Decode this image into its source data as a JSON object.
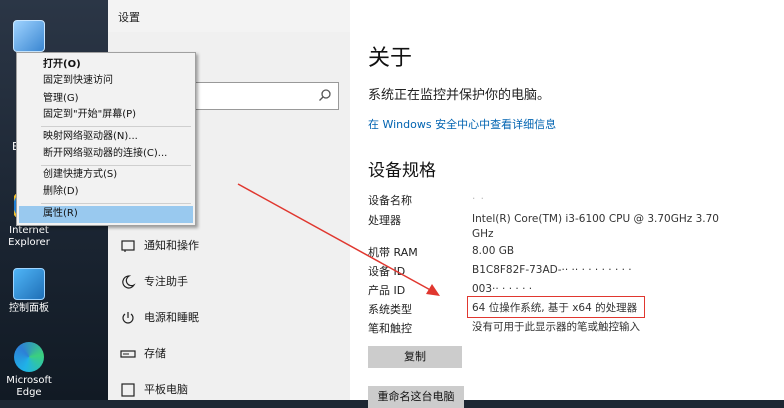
{
  "window": {
    "title": "设置"
  },
  "desktop": {
    "icons": [
      {
        "label": ""
      },
      {
        "label": "Internet Explorer"
      },
      {
        "label": "控制面板"
      },
      {
        "label": "Microsoft Edge"
      }
    ],
    "stray_letter": "E"
  },
  "nav": {
    "items": [
      {
        "label": "通知和操作",
        "icon": "bell-icon"
      },
      {
        "label": "专注助手",
        "icon": "moon-icon"
      },
      {
        "label": "电源和睡眠",
        "icon": "power-icon"
      },
      {
        "label": "存储",
        "icon": "storage-icon"
      },
      {
        "label": "平板电脑",
        "icon": "tablet-icon"
      }
    ]
  },
  "about": {
    "heading": "关于",
    "monitor_text": "系统正在监控并保护你的电脑。",
    "link_text": "在 Windows 安全中心中查看详细信息",
    "spec_heading": "设备规格",
    "rows": [
      {
        "key": "设备名称",
        "value": "·  ·"
      },
      {
        "key": "处理器",
        "value": "Intel(R) Core(TM) i3-6100 CPU @ 3.70GHz   3.70 GHz"
      },
      {
        "key": "机带 RAM",
        "value": "8.00 GB"
      },
      {
        "key": "设备 ID",
        "value": "B1C8F82F-73AD-·· ·· · ·  ·  ·  ·  · · ·"
      },
      {
        "key": "产品 ID",
        "value": "003·· · ·  ·  ·  ·"
      },
      {
        "key": "系统类型",
        "value": "64 位操作系统, 基于 x64 的处理器"
      },
      {
        "key": "笔和触控",
        "value": "没有可用于此显示器的笔或触控输入"
      }
    ],
    "copy_button": "复制",
    "rename_button": "重命名这台电脑"
  },
  "context_menu": {
    "items": [
      "打开(O)",
      "固定到快速访问",
      "管理(G)",
      "固定到\"开始\"屏幕(P)",
      "映射网络驱动器(N)...",
      "断开网络驱动器的连接(C)...",
      "创建快捷方式(S)",
      "删除(D)",
      "属性(R)"
    ],
    "highlighted": "属性(R)"
  },
  "colors": {
    "accent_link": "#0063b1",
    "highlight_red": "#e0372f",
    "menu_selected": "#99c9ef"
  }
}
